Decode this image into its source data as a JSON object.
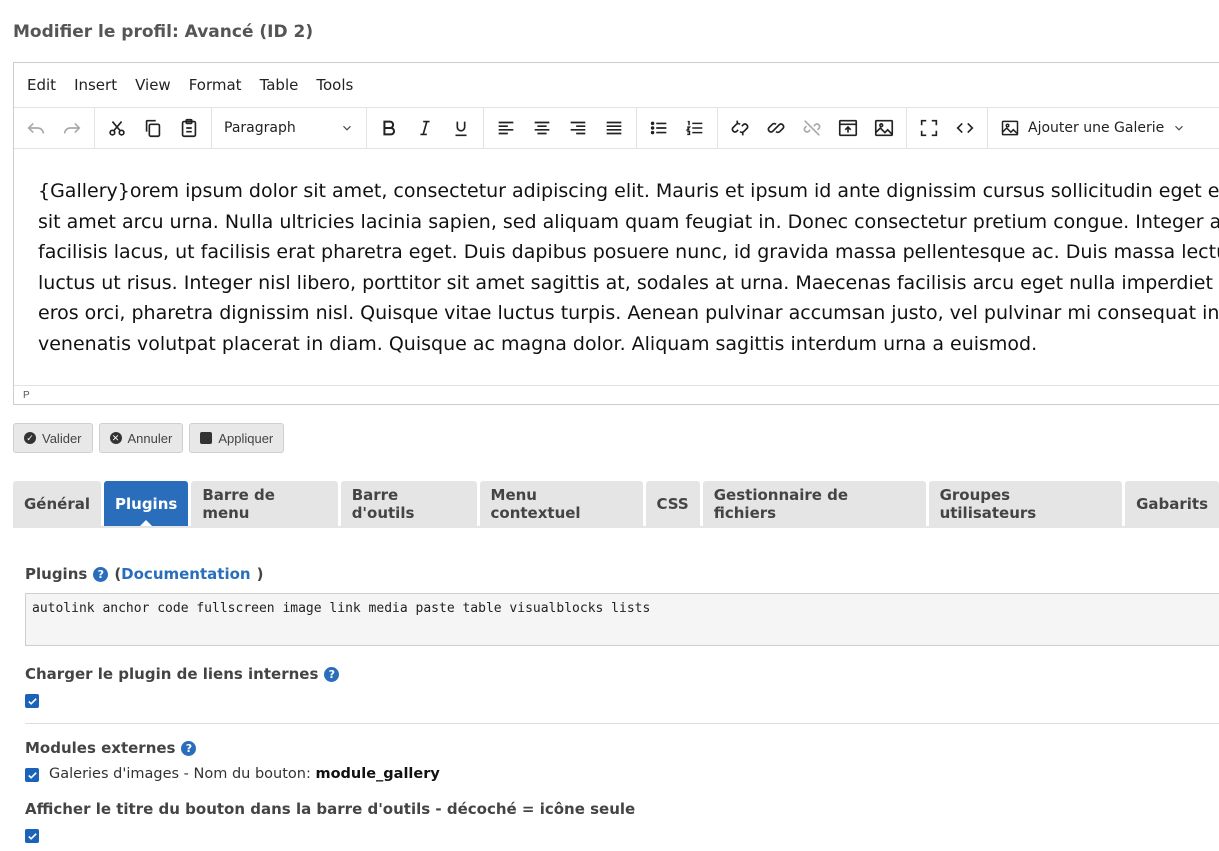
{
  "page": {
    "title": "Modifier le profil: Avancé (ID 2)"
  },
  "editor": {
    "menu": [
      "Edit",
      "Insert",
      "View",
      "Format",
      "Table",
      "Tools"
    ],
    "block_format": "Paragraph",
    "gallery_button": "Ajouter une Galerie",
    "content_lines": [
      "{Gallery}orem ipsum dolor sit amet, consectetur adipiscing elit. Mauris et ipsum id ante dignissim cursus sollicitudin eget erat.",
      "sit amet arcu urna. Nulla ultricies lacinia sapien, sed aliquam quam feugiat in. Donec consectetur pretium congue. Integer aliquam",
      "facilisis lacus, ut facilisis erat pharetra eget. Duis dapibus posuere nunc, id gravida massa pellentesque ac. Duis massa lectus,",
      "luctus ut risus. Integer nisl libero, porttitor sit amet sagittis at, sodales at urna. Maecenas facilisis arcu eget nulla imperdiet sit",
      "eros orci, pharetra dignissim nisl. Quisque vitae luctus turpis. Aenean pulvinar accumsan justo, vel pulvinar mi consequat in.",
      "venenatis volutpat placerat in diam. Quisque ac magna dolor. Aliquam sagittis interdum urna a euismod."
    ],
    "status_path": "P"
  },
  "actions": {
    "save": "Valider",
    "cancel": "Annuler",
    "apply": "Appliquer"
  },
  "tabs": [
    "Général",
    "Plugins",
    "Barre de menu",
    "Barre d'outils",
    "Menu contextuel",
    "CSS",
    "Gestionnaire de fichiers",
    "Groupes utilisateurs",
    "Gabarits"
  ],
  "active_tab": "Plugins",
  "plugins": {
    "label": "Plugins",
    "doc_open": "(",
    "doc_link": "Documentation",
    "doc_close": ")",
    "value": "autolink anchor code fullscreen image link media paste table visualblocks lists"
  },
  "internal_links": {
    "label": "Charger le plugin de liens internes",
    "checked": true
  },
  "external_modules": {
    "label": "Modules externes",
    "item_text": "Galeries d'images - Nom du bouton: ",
    "item_button": "module_gallery",
    "checked": true
  },
  "show_title": {
    "label": "Afficher le titre du bouton dans la barre d'outils - décoché = icône seule",
    "checked": true
  },
  "colors": {
    "accent": "#2a6ebb",
    "checkbox": "#1a63b8"
  }
}
